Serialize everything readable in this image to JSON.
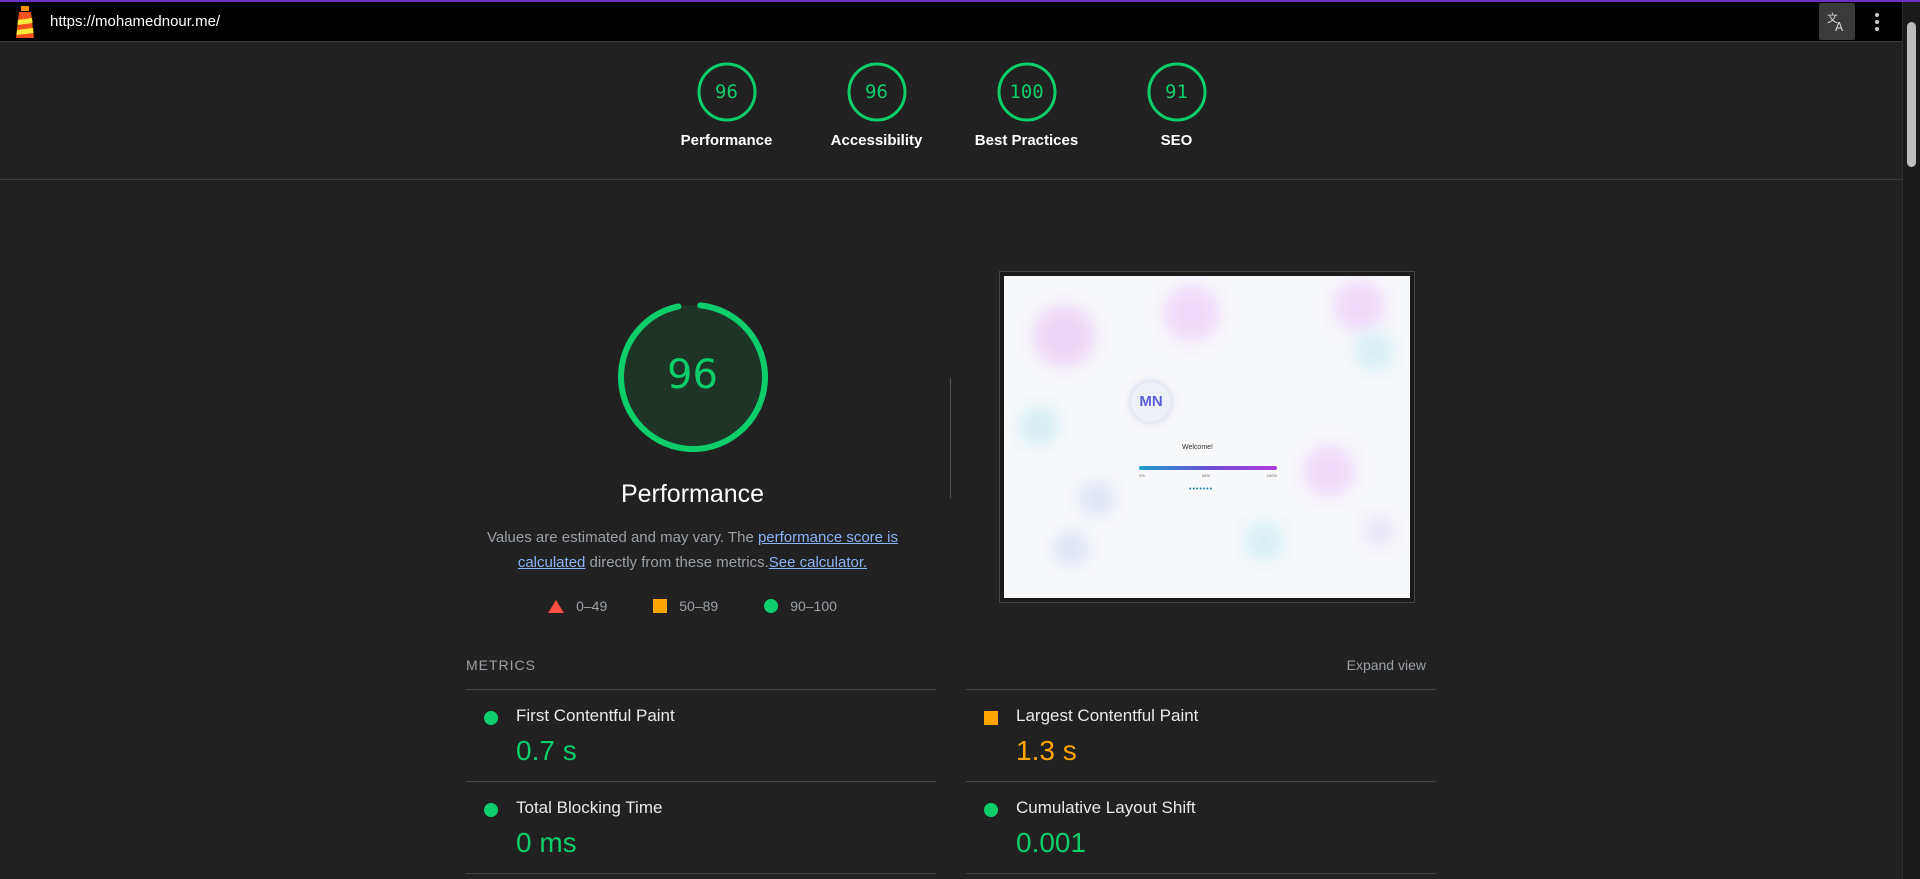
{
  "url": "https://mohamednour.me/",
  "colors": {
    "pass": "#0cce6b",
    "average": "#ffa400",
    "fail": "#ff4e42",
    "accent": "#6b30c9"
  },
  "icons": {
    "logo": "lighthouse-icon",
    "translate": "translate-icon",
    "menu": "more-vert-icon"
  },
  "categories": [
    {
      "score": "96",
      "label": "Performance"
    },
    {
      "score": "96",
      "label": "Accessibility"
    },
    {
      "score": "100",
      "label": "Best Practices"
    },
    {
      "score": "91",
      "label": "SEO"
    }
  ],
  "performance": {
    "score": "96",
    "title": "Performance",
    "desc_prefix": "Values are estimated and may vary. The ",
    "link_score": "performance score is calculated",
    "desc_middle": " directly from these metrics.",
    "link_calc": "See calculator.",
    "legend": {
      "fail": "0–49",
      "average": "50–89",
      "pass": "90–100"
    }
  },
  "screenshot": {
    "initials": "MN",
    "welcome": "Welcome!",
    "bar_min": "0%",
    "bar_mid": "50%",
    "bar_max": "100%"
  },
  "metrics": {
    "title": "METRICS",
    "expand": "Expand view",
    "items": [
      {
        "name": "First Contentful Paint",
        "value": "0.7 s",
        "rating": "pass"
      },
      {
        "name": "Largest Contentful Paint",
        "value": "1.3 s",
        "rating": "average"
      },
      {
        "name": "Total Blocking Time",
        "value": "0 ms",
        "rating": "pass"
      },
      {
        "name": "Cumulative Layout Shift",
        "value": "0.001",
        "rating": "pass"
      }
    ]
  }
}
